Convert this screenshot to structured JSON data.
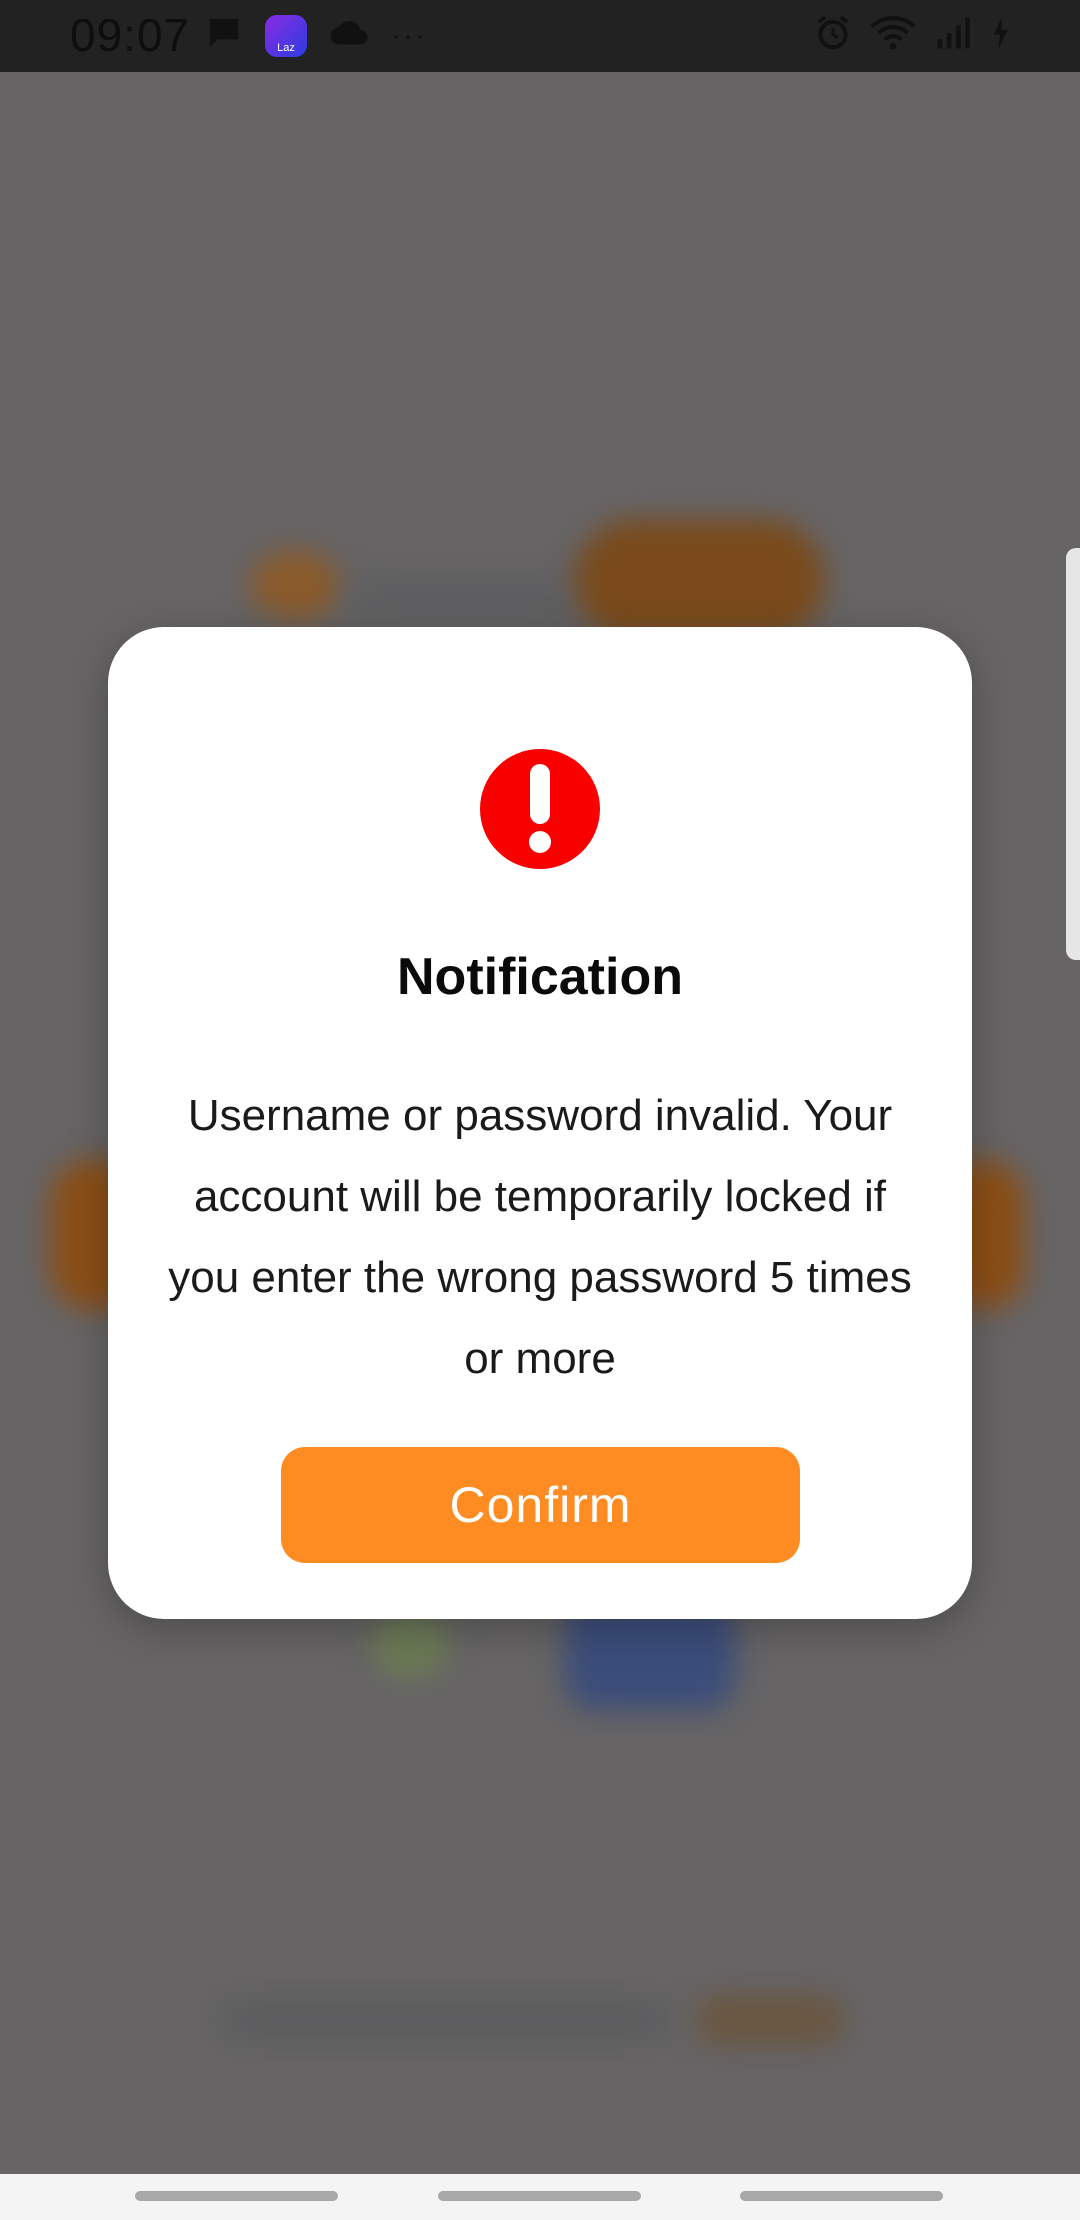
{
  "status_bar": {
    "time": "09:07",
    "icons": [
      "chat-bubble-icon",
      "lazada-app-icon",
      "cloud-icon",
      "more-dots-icon",
      "alarm-icon",
      "wifi-icon",
      "signal-icon",
      "battery-charging-icon"
    ],
    "laz_label": "Laz",
    "more_dots": "···"
  },
  "dialog": {
    "icon": "exclamation-alert-icon",
    "icon_color": "#f80000",
    "title": "Notification",
    "message": "Username or password invalid. Your account will be temporarily locked if you enter the wrong password 5 times or more",
    "confirm_label": "Confirm",
    "confirm_color": "#ff8c22"
  },
  "colors": {
    "overlay": "#666465",
    "accent": "#ff8c22",
    "alert": "#f80000"
  }
}
